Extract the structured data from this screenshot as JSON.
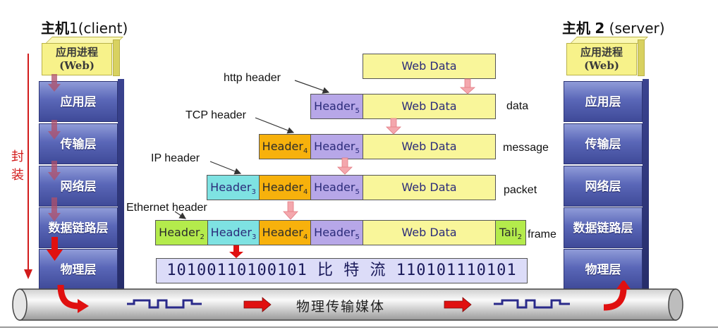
{
  "host1": {
    "title_prefix": "主机",
    "title_num": "1",
    "title_role": "(client)"
  },
  "host2": {
    "title_prefix": "主机",
    "title_num": "2",
    "title_role": "(server)"
  },
  "app_box": {
    "line1": "应用进程",
    "line2": "(Web)"
  },
  "layers": [
    "应用层",
    "传输层",
    "网络层",
    "数据链路层",
    "物理层"
  ],
  "encapsulation_label": [
    "封",
    "装"
  ],
  "header_labels": {
    "http": "http header",
    "tcp": "TCP header",
    "ip": "IP header",
    "ethernet": "Ethernet header"
  },
  "segments": {
    "web_data": "Web Data",
    "header": "Header",
    "tail": "Tail",
    "sub5": "5",
    "sub4": "4",
    "sub3": "3",
    "sub2": "2"
  },
  "pdu_names": {
    "data": "data",
    "message": "message",
    "packet": "packet",
    "frame": "frame"
  },
  "bitstream": "10100110100101 比 特 流 110101110101",
  "medium_label": "物理传输媒体",
  "colors": {
    "web_data": "#f9f69a",
    "header5": "#b7a7e8",
    "header4": "#f7b10c",
    "header3": "#7ee2e2",
    "header2": "#b4eb4c",
    "arrow_red": "#e02020",
    "encap_arrow": "#d21b1b"
  }
}
